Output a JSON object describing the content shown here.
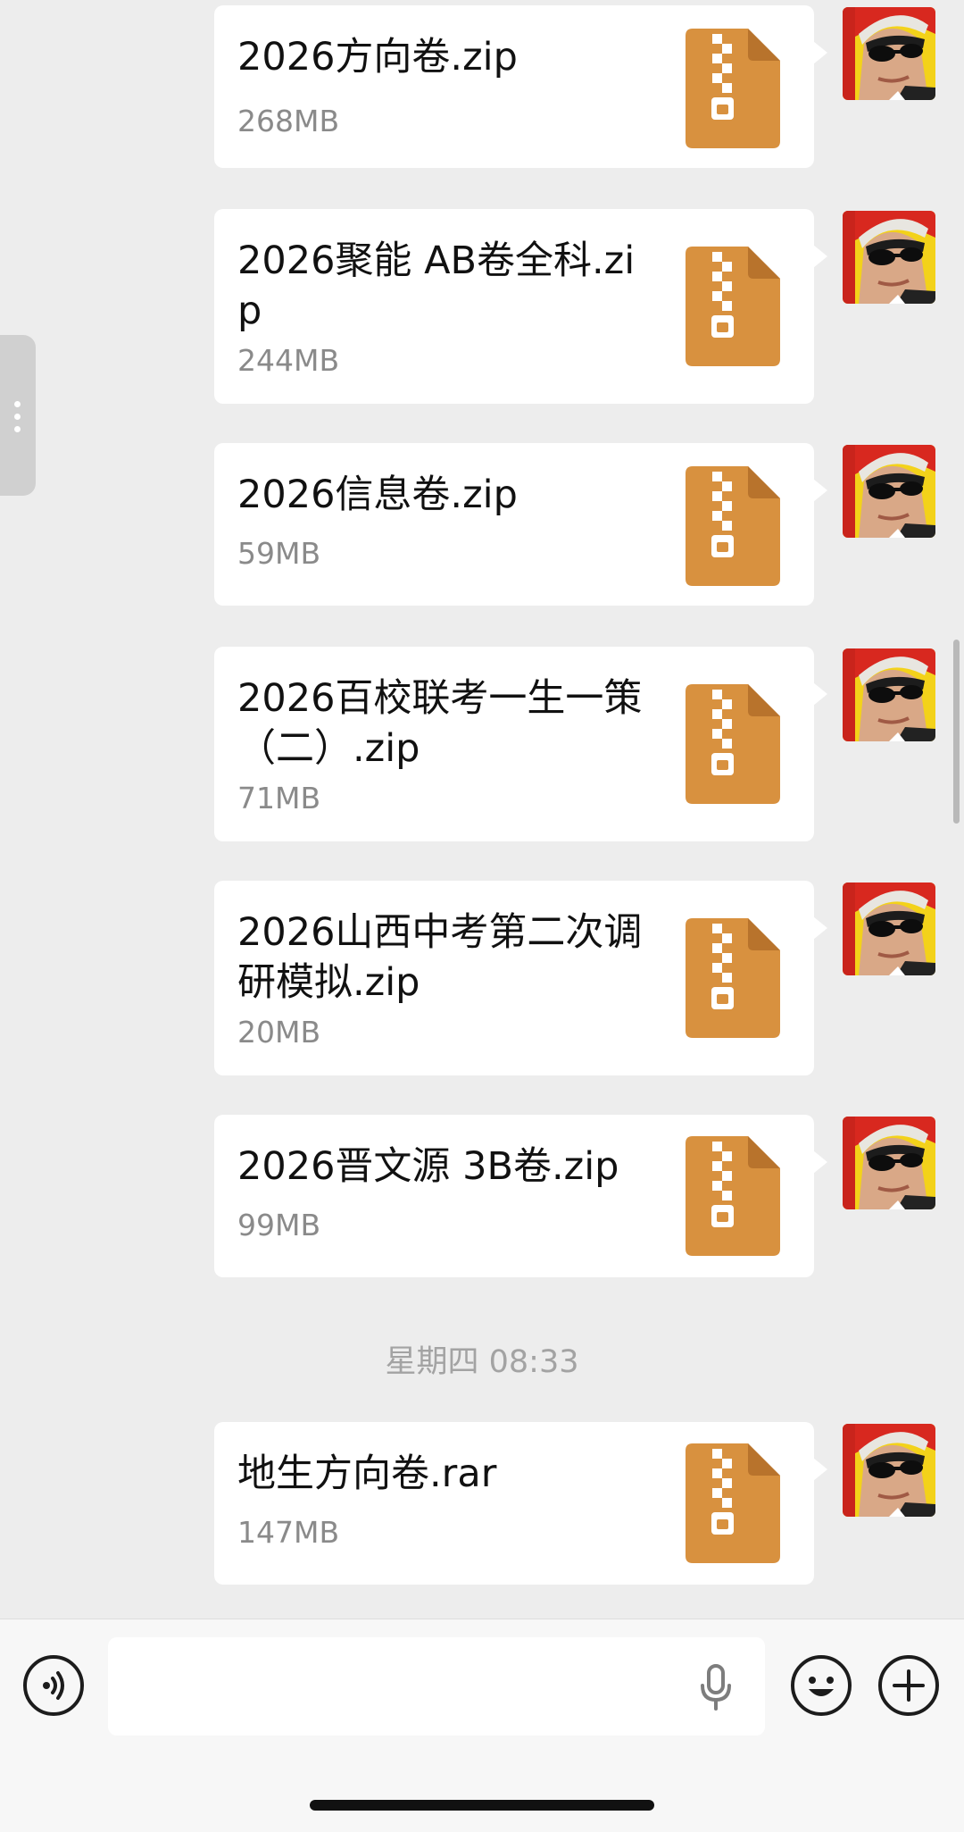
{
  "messages": [
    {
      "name": "2026方向卷.zip",
      "size": "268MB"
    },
    {
      "name": "2026聚能 AB卷全科.zip",
      "size": "244MB"
    },
    {
      "name": "2026信息卷.zip",
      "size": "59MB"
    },
    {
      "name": "2026百校联考一生一策（二）.zip",
      "size": "71MB"
    },
    {
      "name": "2026山西中考第二次调研模拟.zip",
      "size": "20MB"
    },
    {
      "name": "2026晋文源 3B卷.zip",
      "size": "99MB"
    },
    {
      "name": "地生方向卷.rar",
      "size": "147MB"
    }
  ],
  "time_separator": "星期四 08:33",
  "input": {
    "value": "",
    "placeholder": ""
  },
  "icons": {
    "file": "zip-file-icon",
    "voice": "voice-mode-icon",
    "mic": "microphone-icon",
    "emoji": "emoji-icon",
    "more": "plus-icon",
    "avatar": "user-avatar"
  },
  "colors": {
    "background": "#ededed",
    "bubble": "#ffffff",
    "zip_icon": "#d8913f",
    "time_text": "#a3a3a3",
    "size_text": "#8a8a8a"
  }
}
